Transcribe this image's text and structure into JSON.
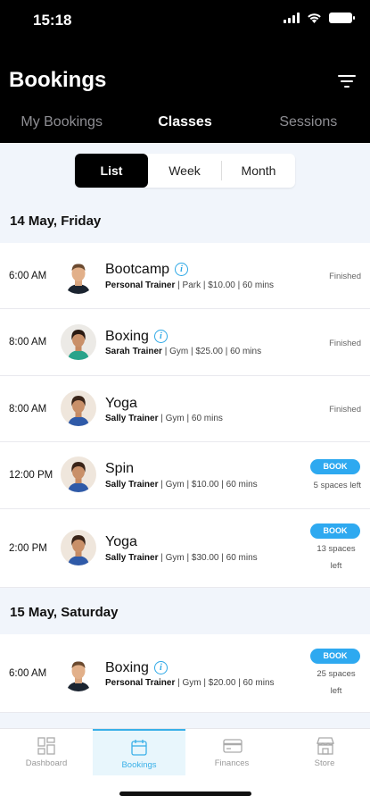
{
  "status_bar": {
    "time": "15:18"
  },
  "header": {
    "title": "Bookings"
  },
  "tabs": [
    {
      "label": "My Bookings",
      "active": false
    },
    {
      "label": "Classes",
      "active": true
    },
    {
      "label": "Sessions",
      "active": false
    }
  ],
  "view_toggle": {
    "list": "List",
    "week": "Week",
    "month": "Month",
    "selected": "List"
  },
  "days": [
    {
      "date": "14 May, Friday",
      "classes": [
        {
          "time": "6:00 AM",
          "name": "Bootcamp",
          "trainer": "Personal Trainer",
          "meta": " | Park | $10.00 | 60 mins",
          "status": "Finished"
        },
        {
          "time": "8:00 AM",
          "name": "Boxing",
          "trainer": "Sarah Trainer",
          "meta": " | Gym | $25.00 | 60 mins",
          "status": "Finished"
        },
        {
          "time": "8:00 AM",
          "name": "Yoga",
          "trainer": "Sally Trainer",
          "meta": " | Gym | 60 mins",
          "status": "Finished"
        },
        {
          "time": "12:00 PM",
          "name": "Spin",
          "trainer": "Sally Trainer",
          "meta": " | Gym | $10.00 | 60 mins",
          "book": "BOOK",
          "spaces": "5 spaces left"
        },
        {
          "time": "2:00 PM",
          "name": "Yoga",
          "trainer": "Sally Trainer",
          "meta": " | Gym | $30.00 | 60 mins",
          "book": "BOOK",
          "spaces_line1": "13 spaces",
          "spaces_line2": "left"
        }
      ]
    },
    {
      "date": "15 May, Saturday",
      "classes": [
        {
          "time": "6:00 AM",
          "name": "Boxing",
          "trainer": "Personal Trainer",
          "meta": " | Gym | $20.00 | 60 mins",
          "book": "BOOK",
          "spaces_line1": "25 spaces",
          "spaces_line2": "left"
        }
      ]
    }
  ],
  "bottom_nav": [
    {
      "label": "Dashboard",
      "icon": "dashboard-icon"
    },
    {
      "label": "Bookings",
      "icon": "calendar-icon",
      "active": true
    },
    {
      "label": "Finances",
      "icon": "card-icon"
    },
    {
      "label": "Store",
      "icon": "store-icon"
    }
  ],
  "colors": {
    "accent": "#2ea9f0",
    "header_bg": "#000000",
    "page_bg": "#f1f5fb"
  }
}
